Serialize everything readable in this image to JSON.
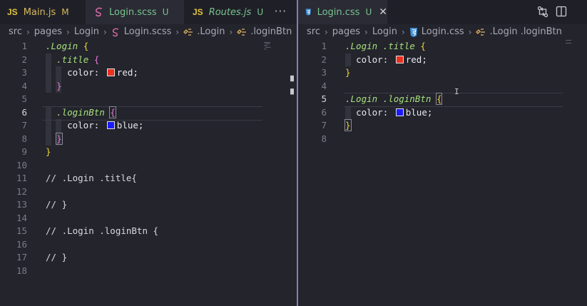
{
  "left": {
    "tabs": [
      {
        "icon": "JS",
        "name": "Main.js",
        "badge": "M"
      },
      {
        "name": "Login.scss",
        "badge": "U"
      },
      {
        "icon": "JS",
        "name": "Routes.js",
        "badge": "U"
      }
    ],
    "overflow": "···",
    "breadcrumb": [
      "src",
      "pages",
      "Login",
      "Login.scss",
      ".Login",
      ".loginBtn"
    ],
    "lines": [
      "1",
      "2",
      "3",
      "4",
      "5",
      "6",
      "7",
      "8",
      "9",
      "10",
      "11",
      "12",
      "13",
      "14",
      "15",
      "16",
      "17",
      "18"
    ],
    "code": {
      "l1_sel": ".Login",
      "l1_br": "{",
      "l2_sel": ".title",
      "l2_br": "{",
      "l3_prop": "color:",
      "l3_val": "red;",
      "l4_br": "}",
      "l6_sel": ".loginBtn",
      "l6_br": "{",
      "l7_prop": "color:",
      "l7_val": "blue;",
      "l8_br": "}",
      "l9_br": "}",
      "l11": "// .Login .title{",
      "l13": "// }",
      "l15": "// .Login .loginBtn {",
      "l17": "// }"
    }
  },
  "right": {
    "tabs": [
      {
        "name": "Login.css",
        "badge": "U"
      }
    ],
    "breadcrumb": [
      "src",
      "pages",
      "Login",
      "Login.css",
      ".Login .loginBtn"
    ],
    "lines": [
      "1",
      "2",
      "3",
      "4",
      "5",
      "6",
      "7",
      "8"
    ],
    "code": {
      "l1_sel": ".Login .title",
      "l1_br": "{",
      "l2_prop": "color:",
      "l2_val": "red;",
      "l3_br": "}",
      "l5_sel": ".Login .loginBtn",
      "l5_br": "{",
      "l6_prop": "color:",
      "l6_val": "blue;",
      "l7_br": "}"
    }
  },
  "colors": {
    "red": "#e8321f",
    "blue": "#1a1aff",
    "accent": "#7f7fb8"
  }
}
